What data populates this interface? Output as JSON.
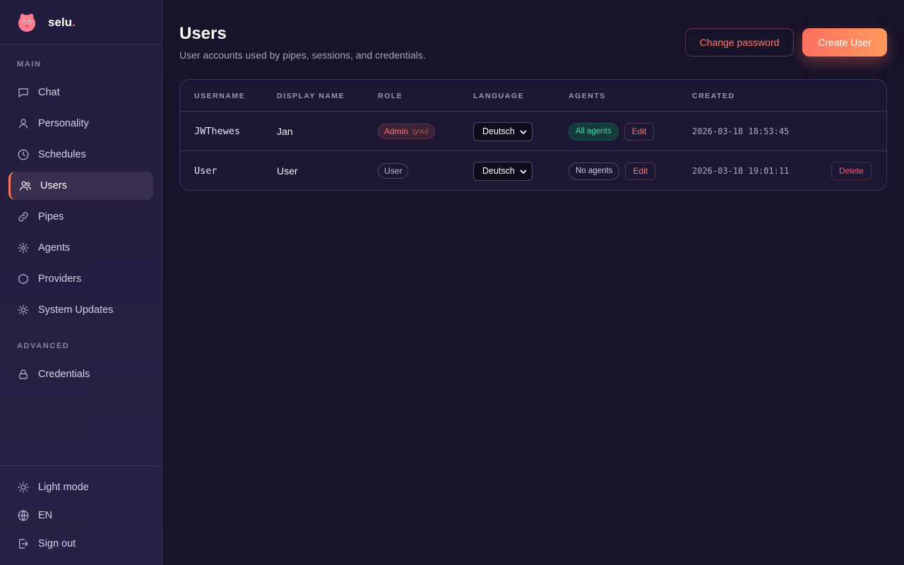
{
  "brand": {
    "name": "selu",
    "dot": "."
  },
  "sidebar": {
    "section_main": "MAIN",
    "section_advanced": "ADVANCED",
    "items": [
      {
        "label": "Chat",
        "icon": "chat-icon"
      },
      {
        "label": "Personality",
        "icon": "person-icon"
      },
      {
        "label": "Schedules",
        "icon": "clock-icon"
      },
      {
        "label": "Users",
        "icon": "users-icon",
        "active": true
      },
      {
        "label": "Pipes",
        "icon": "link-icon"
      },
      {
        "label": "Agents",
        "icon": "spark-icon"
      },
      {
        "label": "Providers",
        "icon": "hexagon-icon"
      },
      {
        "label": "System Updates",
        "icon": "sun-gear-icon"
      }
    ],
    "advanced_items": [
      {
        "label": "Credentials",
        "icon": "lock-icon"
      }
    ],
    "bottom": {
      "theme": "Light mode",
      "language": "EN",
      "sign_out": "Sign out"
    }
  },
  "header": {
    "title": "Users",
    "subtitle": "User accounts used by pipes, sessions, and credentials.",
    "change_password": "Change password",
    "create_user": "Create User"
  },
  "table": {
    "columns": {
      "username": "USERNAME",
      "display_name": "DISPLAY NAME",
      "role": "ROLE",
      "language": "LANGUAGE",
      "agents": "AGENTS",
      "created": "CREATED"
    },
    "rows": [
      {
        "username": "JWThewes",
        "display_name": "Jan",
        "role": "Admin",
        "role_note": "(you)",
        "language": "Deutsch",
        "agents": "All agents",
        "edit": "Edit",
        "created": "2026-03-18 18:53:45"
      },
      {
        "username": "User",
        "display_name": "User",
        "role": "User",
        "language": "Deutsch",
        "agents": "No agents",
        "edit": "Edit",
        "created": "2026-03-18 19:01:11",
        "delete": "Delete"
      }
    ]
  },
  "colors": {
    "accent": "#ff7a5c",
    "background": "#17132a",
    "sidebar": "#231e40",
    "success": "#49d7a8",
    "danger": "#ff5b7a"
  }
}
